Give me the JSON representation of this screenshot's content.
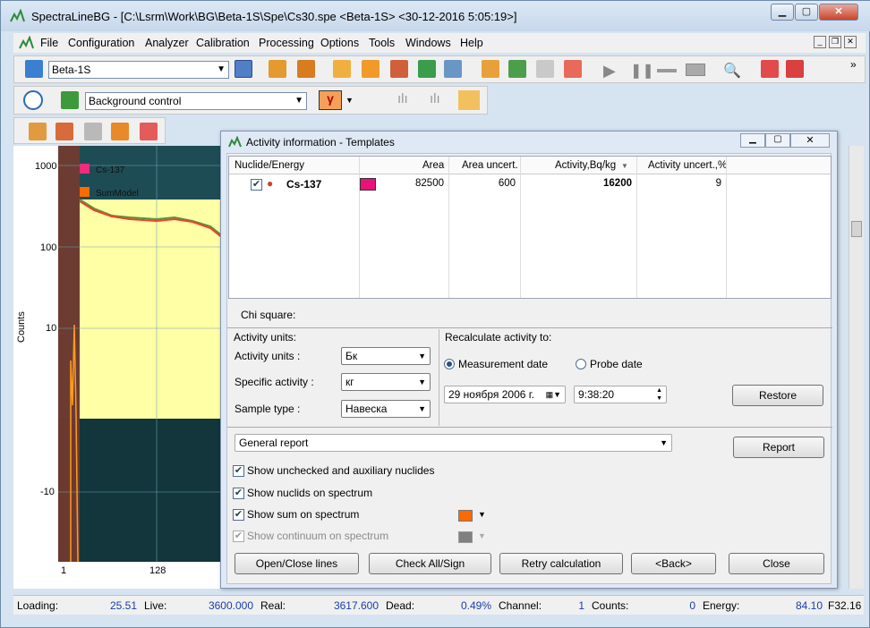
{
  "window": {
    "title": "SpectraLineBG - [C:\\Lsrm\\Work\\BG\\Beta-1S\\Spe\\Cs30.spe <Beta-1S> <30-12-2016 5:05:19>]"
  },
  "menu": [
    "File",
    "Configuration",
    "Analyzer",
    "Calibration",
    "Processing",
    "Options",
    "Tools",
    "Windows",
    "Help"
  ],
  "toolbar": {
    "detector": "Beta-1S",
    "mode": "Background control"
  },
  "plot": {
    "ylabel": "Counts",
    "yticks": [
      "1000",
      "100",
      "10",
      "-10"
    ],
    "xticks": [
      "1",
      "128"
    ],
    "legend": [
      "Cs-137",
      "SumModel"
    ],
    "colors": {
      "cs137": "#f02a7c",
      "summodel": "#ff6a00"
    }
  },
  "dialog": {
    "title": "Activity information - Templates",
    "columns": [
      "Nuclide/Energy",
      "Area",
      "Area uncert.",
      "Activity,Bq/kg",
      "Activity uncert.,%"
    ],
    "rows": [
      {
        "nuclide": "Cs-137",
        "area": "82500",
        "area_uncert": "600",
        "activity": "16200",
        "activity_uncert": "9",
        "color": "#e8127a",
        "checked": true
      }
    ],
    "chi_square_label": "Chi square:",
    "activity_units": {
      "group": "Activity units:",
      "units_label": "Activity units :",
      "units_value": "Бк",
      "specific_label": "Specific activity :",
      "specific_value": "кг",
      "sample_label": "Sample type :",
      "sample_value": "Навеска"
    },
    "recalc": {
      "group": "Recalculate activity to:",
      "measurement_date": "Measurement date",
      "probe_date": "Probe date",
      "date_value": "29  ноября  2006 г.",
      "time_value": "9:38:20",
      "restore": "Restore"
    },
    "report": {
      "selected": "General report",
      "button": "Report"
    },
    "options": [
      {
        "label": "Show unchecked and auxiliary nuclides",
        "checked": true,
        "enabled": true
      },
      {
        "label": "Show nuclids on spectrum",
        "checked": true,
        "enabled": true
      },
      {
        "label": "Show sum on spectrum",
        "checked": true,
        "enabled": true
      },
      {
        "label": "Show continuum on spectrum",
        "checked": true,
        "enabled": false
      }
    ],
    "sum_color": "#ff6a00",
    "continuum_color": "#808080",
    "buttons": [
      "Open/Close lines",
      "Check All/Sign",
      "Retry calculation",
      "<Back>",
      "Close"
    ]
  },
  "status": {
    "loading_label": "Loading:",
    "loading": "25.51",
    "live_label": "Live:",
    "live": "3600.000",
    "real_label": "Real:",
    "real": "3617.600",
    "dead_label": "Dead:",
    "dead": "0.49%",
    "channel_label": "Channel:",
    "channel": "1",
    "counts_label": "Counts:",
    "counts": "0",
    "energy_label": "Energy:",
    "energy": "84.10",
    "extra": "F32.16"
  }
}
